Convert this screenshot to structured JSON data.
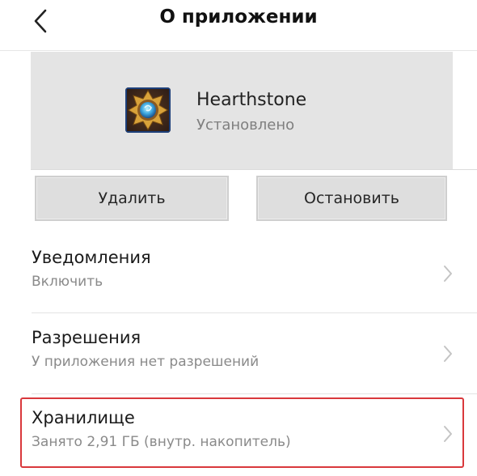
{
  "header": {
    "title": "О приложении",
    "back_icon": "chevron-left-icon"
  },
  "app": {
    "name": "Hearthstone",
    "status": "Установлено",
    "icon": "hearthstone-app-icon"
  },
  "actions": {
    "delete_label": "Удалить",
    "stop_label": "Остановить"
  },
  "settings": [
    {
      "title": "Уведомления",
      "subtitle": "Включить",
      "icon": "chevron-right-icon"
    },
    {
      "title": "Разрешения",
      "subtitle": "У приложения нет разрешений",
      "icon": "chevron-right-icon"
    },
    {
      "title": "Хранилище",
      "subtitle": "Занято 2,91 ГБ (внутр. накопитель)",
      "icon": "chevron-right-icon",
      "highlighted": true
    }
  ],
  "colors": {
    "highlight": "#d9383c",
    "card_bg": "#e4e4e4",
    "secondary_text": "#8a8a8a"
  }
}
